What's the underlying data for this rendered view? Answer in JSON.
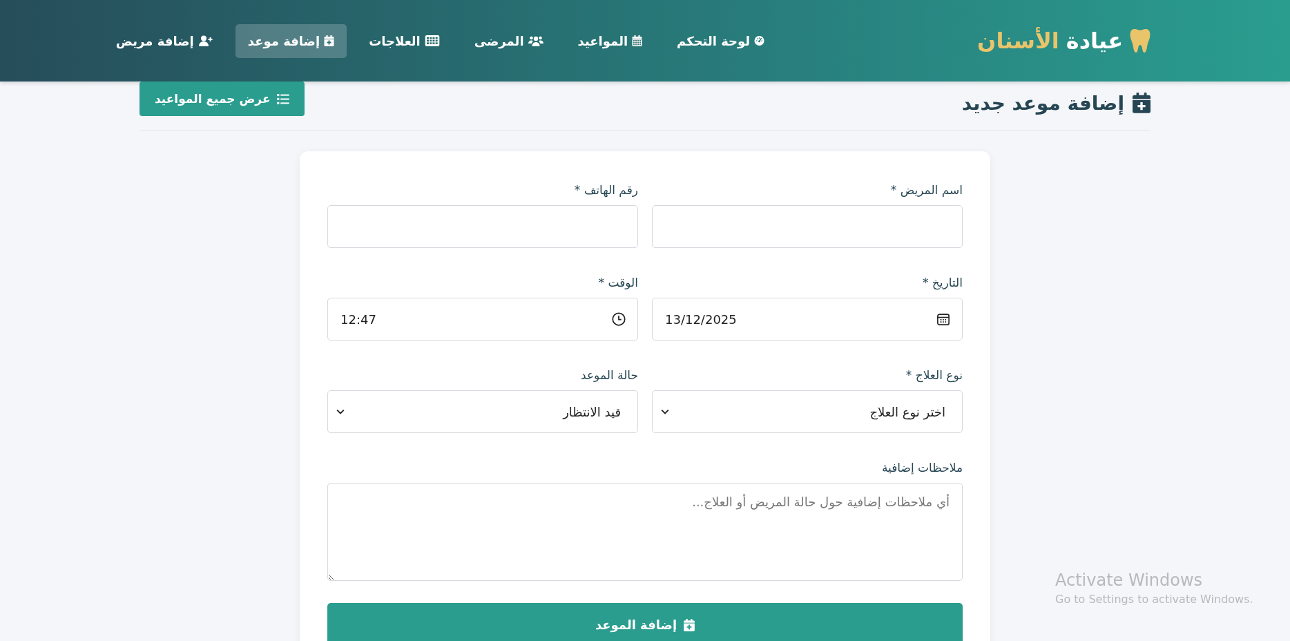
{
  "navbar": {
    "brand": {
      "main": "عيادة",
      "accent": "الأسنان"
    },
    "items": [
      {
        "label": "لوحة التحكم",
        "kind": "gauge",
        "selected": false
      },
      {
        "label": "المواعيد",
        "kind": "calendar",
        "selected": false
      },
      {
        "label": "المرضى",
        "kind": "users",
        "selected": false
      },
      {
        "label": "العلاجات",
        "kind": "grid",
        "selected": false
      },
      {
        "label": "إضافة موعد",
        "kind": "calendar-plus",
        "selected": true
      },
      {
        "label": "إضافة مريض",
        "kind": "user-plus",
        "selected": false
      }
    ]
  },
  "page_header": {
    "title": "إضافة موعد جديد",
    "button": "عرض جميع المواعيد"
  },
  "form": {
    "fields": [
      {
        "kind": "text",
        "label": "اسم المريض *"
      },
      {
        "kind": "text",
        "label": "رقم الهاتف *"
      },
      {
        "kind": "date",
        "label": "التاريخ *",
        "value": "13/12/2025"
      },
      {
        "kind": "time",
        "label": "الوقت *",
        "value": "12:47"
      },
      {
        "kind": "select",
        "label": "نوع العلاج *",
        "value": "اختر نوع العلاج"
      },
      {
        "kind": "select",
        "label": "حالة الموعد",
        "value": "قيد الانتظار"
      },
      {
        "kind": "textarea",
        "label": "ملاحظات إضافية",
        "placeholder": "أي ملاحظات إضافية حول حالة المريض أو العلاج..."
      }
    ],
    "submit": "إضافة الموعد"
  },
  "os_notice": {
    "title": "Activate Windows",
    "text": "Go to Settings to activate Windows."
  }
}
